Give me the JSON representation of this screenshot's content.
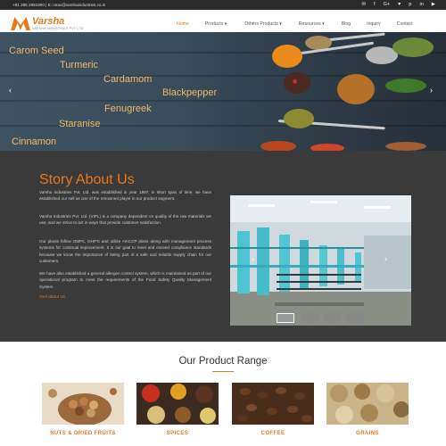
{
  "topbar": {
    "contact": "+91 285 2661900 | E: nirav@varshaindustries.co.in",
    "social_icons": [
      "email-icon",
      "facebook-icon",
      "google-plus-icon",
      "twitter-icon",
      "pinterest-icon",
      "linkedin-icon",
      "youtube-icon"
    ],
    "social_glyphs": [
      "✉",
      "f",
      "G+",
      "♥",
      "p",
      "in",
      "▶"
    ]
  },
  "brand": {
    "name": "Varsha",
    "tagline": "VARSHA INDUSTRIES PVT LTD",
    "color": "#e37a1d"
  },
  "nav": {
    "items": [
      {
        "label": "Home",
        "active": true
      },
      {
        "label": "Products ▾"
      },
      {
        "label": "Others Products ▾"
      },
      {
        "label": "Resources ▾"
      },
      {
        "label": "Blog"
      },
      {
        "label": "Inquiry"
      },
      {
        "label": "Contact"
      }
    ]
  },
  "hero": {
    "labels": [
      "Carom Seed",
      "Turmeric",
      "Cardamom",
      "Blackpepper",
      "Fenugreek",
      "Staranise",
      "Cinnamon"
    ],
    "prev": "‹",
    "next": "›"
  },
  "story": {
    "title": "Story About Us",
    "paragraphs": [
      "Varsha Industries Pvt. Ltd. was established in year 1997, in short span of time, we have established our self as one of the renowned player in our product segment.",
      "Varsha Industries Pvt. Ltd. (VIPL) is a company dependent on quality of the raw materials we use, and we strive to act in ways that provide customer satisfaction.",
      "Our plants follow GMPs, GHP'S and utilize HACCP plans along with management process systems for continual improvement. It is our goal to meet and exceed compliance standards because we know the importance of being part of a safe and reliable supply chain for our customers.",
      "We have also established a general allergen control system, which is maintained as part of our operational program to meet the requirements of the Food Safety Quality Management System."
    ],
    "read_more": "Red about Us",
    "photo_prev": "‹",
    "photo_next": "›"
  },
  "products": {
    "title": "Our Product Range",
    "items": [
      {
        "label": "NUTS & DRIED FRUITS"
      },
      {
        "label": "SPICES"
      },
      {
        "label": "COFFEE"
      },
      {
        "label": "GRAINS"
      }
    ]
  }
}
